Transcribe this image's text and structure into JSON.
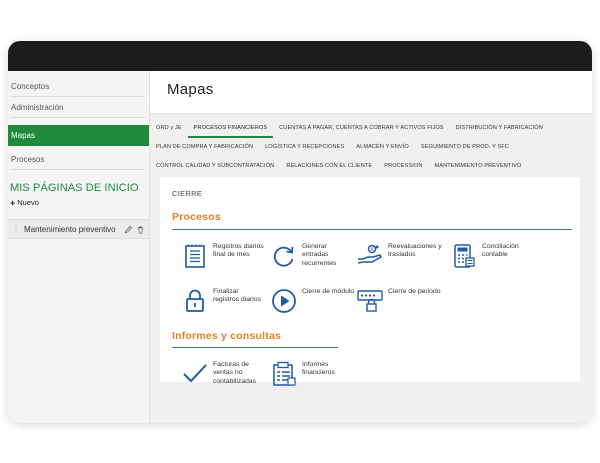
{
  "sidebar": {
    "items": [
      {
        "label": "Conceptos"
      },
      {
        "label": "Administración"
      },
      {
        "label": "Mapas"
      },
      {
        "label": "Procesos"
      }
    ],
    "my_pages_title": "MIS PÁGINAS DE INICIO",
    "new_label": "Nuevo",
    "favorites": [
      {
        "label": "Mantenimiento preventivo"
      }
    ]
  },
  "header": {
    "title": "Mapas"
  },
  "tabs": {
    "row1": [
      "ORD y JE",
      "PROCESOS FINANCIEROS",
      "CUENTAS A PAGAR, CUENTAS A COBRAR Y ACTIVOS FIJOS",
      "DISTRIBUCIÓN Y FABRICACIÓN"
    ],
    "row2": [
      "PLAN DE COMPRA Y FABRICACIÓN",
      "LOGÍSTICA Y RECEPCIONES",
      "ALMACÉN Y ENVÍO",
      "SEGUIMIENTO DE PROD. Y SFC"
    ],
    "row3": [
      "CONTROL CALIDAD Y SUBCONTRATACIÓN",
      "RELACIONES CON EL CLIENTE",
      "PROCESSION",
      "MANTENIMIENTO PREVENTIVO"
    ],
    "active": "PROCESOS FINANCIEROS"
  },
  "content": {
    "subtitle": "CIERRE",
    "procesos_title": "Procesos",
    "procesos": [
      {
        "label": "Registros diarios final de mes",
        "icon": "journal-icon"
      },
      {
        "label": "Generar entradas recurrentes",
        "icon": "refresh-icon"
      },
      {
        "label": "Reevaluaciones y traslados",
        "icon": "money-hand-icon"
      },
      {
        "label": "Conciliación contable",
        "icon": "calculator-icon"
      },
      {
        "label": "Finalizar registros diarios",
        "icon": "lock-icon"
      },
      {
        "label": "Cierre de módulo",
        "icon": "play-icon"
      },
      {
        "label": "Cierre de periodo",
        "icon": "password-lock-icon"
      }
    ],
    "informes_title": "Informes y consultas",
    "informes": [
      {
        "label": "Facturas de ventas no contabilizadas",
        "icon": "checkmark-icon"
      },
      {
        "label": "Informes financieros",
        "icon": "report-icon"
      }
    ]
  },
  "colors": {
    "accent_green": "#1f8a3c",
    "section_orange": "#e2801f",
    "icon_blue": "#1f5aa6",
    "topbar": "#1c1c1c"
  }
}
